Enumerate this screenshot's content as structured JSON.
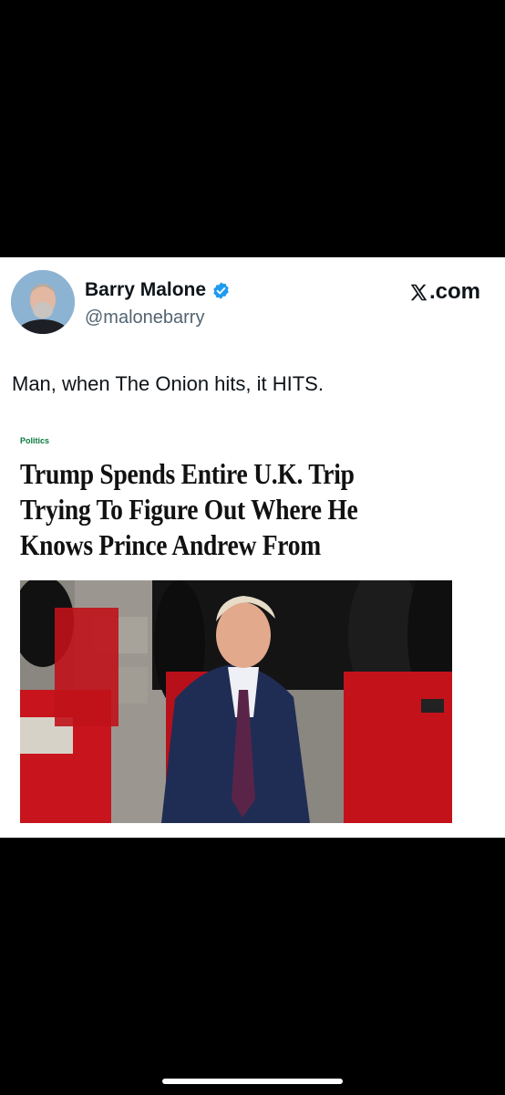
{
  "tweet": {
    "author_name": "Barry Malone",
    "handle": "@malonebarry",
    "verified": true,
    "site": ".com",
    "site_icon": "x-logo-icon",
    "text": "Man, when The Onion hits, it HITS."
  },
  "article": {
    "section": "Politics",
    "headline": "Trump Spends Entire U.K. Trip Trying To Figure Out Where He Knows Prince Andrew From"
  },
  "colors": {
    "verified_blue": "#1d9bf0",
    "section_green": "#0a7a3c",
    "background": "#000000"
  }
}
